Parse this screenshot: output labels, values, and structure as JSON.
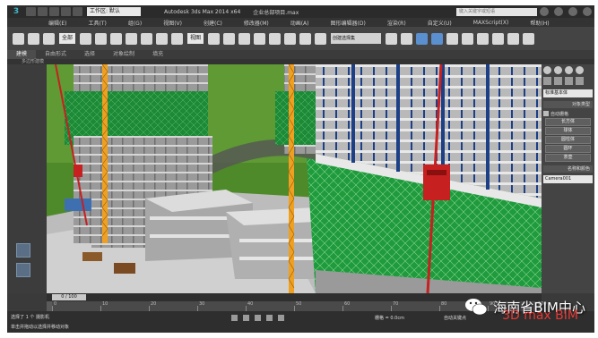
{
  "window": {
    "title": "Autodesk 3ds Max 2014 x64",
    "file": "企业总部项目.max",
    "workspace": "工作区: 默认",
    "search_placeholder": "键入关键字或短语"
  },
  "menu": [
    "编辑(E)",
    "工具(T)",
    "组(G)",
    "视图(V)",
    "创建(C)",
    "修改器(M)",
    "动画(A)",
    "图形编辑器(D)",
    "渲染(R)",
    "自定义(U)",
    "MAXScript(X)",
    "帮助(H)"
  ],
  "toolbar": {
    "selection_filter": "全部",
    "coord_system": "视图",
    "named_selection": "创建选择集"
  },
  "ribbon": {
    "tabs": [
      "建模",
      "自由形式",
      "选择",
      "对象绘制",
      "填充"
    ],
    "active_tab": "建模",
    "sub_label": "多边形建模"
  },
  "command_panel": {
    "category": "标准基本体",
    "rollout_title": "对象类型",
    "autogrid": "自动栅格",
    "object_buttons": [
      "长方体",
      "球体",
      "圆柱体",
      "圆环",
      "茶壶"
    ],
    "name_rollout": "名称和颜色",
    "object_name": "Camera001"
  },
  "timeline": {
    "frame_label": "0 / 100",
    "current_frame": 0,
    "total_frames": 100,
    "tick_labels": [
      "0",
      "10",
      "20",
      "30",
      "40",
      "50",
      "60",
      "70",
      "80",
      "90",
      "100"
    ]
  },
  "status": {
    "selection": "选择了 1 个 摄影机",
    "prompt": "单击并拖动以选择并移动对象",
    "grid": "栅格 = 0.0cm",
    "autokey": "自动关键点"
  },
  "watermark": {
    "title": "海南省BIM中心",
    "subtitle": "3D max BIM"
  },
  "colors": {
    "net_green": "#1f8f3a",
    "steel_blue": "#1c3f86",
    "tower_orange": "#f0a020",
    "hoist_red": "#c62020",
    "grass": "#4f8a2a"
  }
}
